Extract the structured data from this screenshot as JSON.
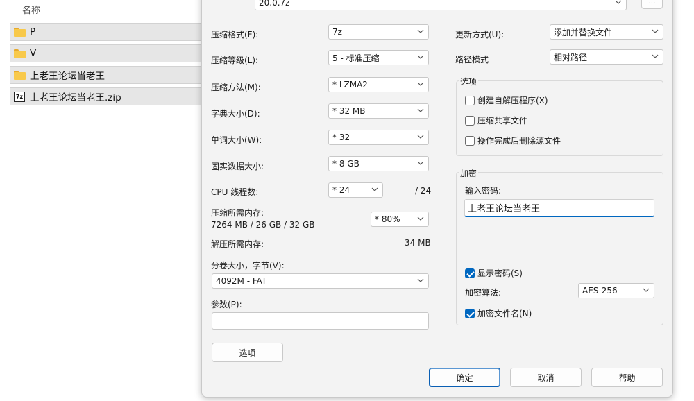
{
  "explorer": {
    "column_header": "名称",
    "items": [
      {
        "name": "P",
        "icon": "folder-icon"
      },
      {
        "name": "V",
        "icon": "folder-icon"
      },
      {
        "name": "上老王论坛当老王",
        "icon": "folder-icon"
      },
      {
        "name": "上老王论坛当老王.zip",
        "icon": "zip-icon",
        "icon_text": "7z"
      }
    ]
  },
  "dialog": {
    "archive_path": "20.0.7z",
    "browse_label": "...",
    "format": {
      "label": "压缩格式(F):",
      "value": "7z"
    },
    "level": {
      "label": "压缩等级(L):",
      "value": "5 - 标准压缩"
    },
    "method": {
      "label": "压缩方法(M):",
      "value": "* LZMA2"
    },
    "dict_size": {
      "label": "字典大小(D):",
      "value": "* 32 MB"
    },
    "word_size": {
      "label": "单词大小(W):",
      "value": "* 32"
    },
    "solid_size": {
      "label": "固实数据大小:",
      "value": "* 8 GB"
    },
    "cpu_threads": {
      "label": "CPU 线程数:",
      "value": "* 24",
      "max": "/ 24"
    },
    "memory_compress": {
      "label": "压缩所需内存:",
      "detail": "7264 MB / 26 GB / 32 GB",
      "value": "* 80%"
    },
    "memory_decompress": {
      "label": "解压所需内存:",
      "value": "34 MB"
    },
    "split": {
      "label": "分卷大小，字节(V):",
      "value": "4092M - FAT"
    },
    "params": {
      "label": "参数(P):",
      "value": ""
    },
    "options_button": "选项",
    "update_mode": {
      "label": "更新方式(U):",
      "value": "添加并替换文件"
    },
    "path_mode": {
      "label": "路径模式",
      "value": "相对路径"
    },
    "options_group": {
      "title": "选项",
      "sfx": "创建自解压程序(X)",
      "shared": "压缩共享文件",
      "delete_after": "操作完成后删除源文件"
    },
    "encryption": {
      "title": "加密",
      "password_label": "输入密码:",
      "password_value": "上老王论坛当老王",
      "show_password": "显示密码(S)",
      "method_label": "加密算法:",
      "method_value": "AES-256",
      "encrypt_names": "加密文件名(N)"
    },
    "buttons": {
      "ok": "确定",
      "cancel": "取消",
      "help": "帮助"
    }
  },
  "colors": {
    "accent": "#0067c0",
    "folder": "#f8c94a",
    "dialog_bg": "#f3f3f3"
  }
}
